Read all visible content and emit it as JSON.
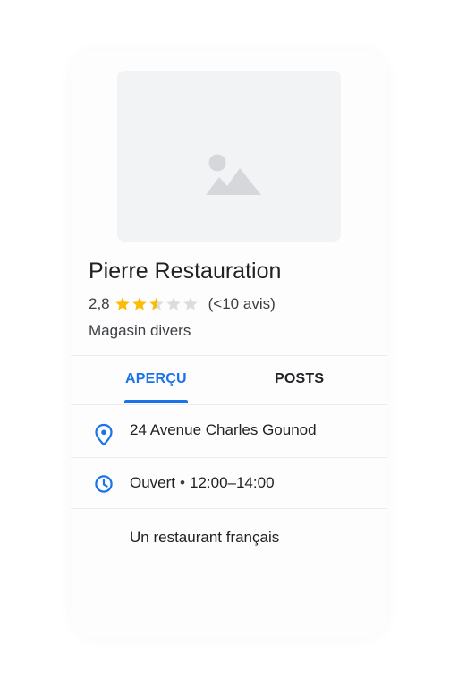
{
  "place": {
    "name": "Pierre Restauration",
    "rating_value": "2,8",
    "rating_stars": 2.8,
    "review_count": "(<10 avis)",
    "category": "Magasin divers"
  },
  "tabs": [
    {
      "label": "APERÇU",
      "active": true
    },
    {
      "label": "POSTS",
      "active": false
    }
  ],
  "info": {
    "address": "24 Avenue Charles Gounod",
    "hours_status": "Ouvert",
    "hours_separator": "•",
    "hours_range": "12:00–14:00",
    "description": "Un restaurant français"
  },
  "icons": {
    "address": "location-pin-icon",
    "hours": "clock-icon",
    "photo": "image-placeholder-icon",
    "star": "star-icon"
  },
  "colors": {
    "accent": "#1a73e8",
    "star_filled": "#fbbc04",
    "star_empty": "#dadce0"
  }
}
